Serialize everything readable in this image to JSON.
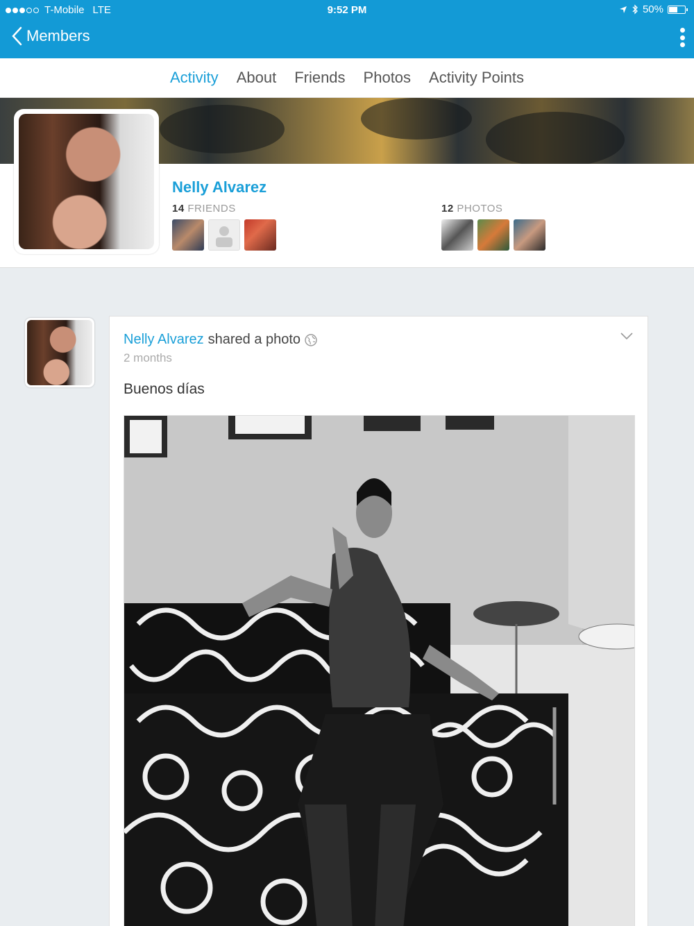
{
  "status_bar": {
    "carrier": "T-Mobile",
    "network": "LTE",
    "time": "9:52 PM",
    "battery": "50%"
  },
  "nav": {
    "back_label": "Members"
  },
  "tabs": [
    {
      "label": "Activity",
      "active": true
    },
    {
      "label": "About"
    },
    {
      "label": "Friends"
    },
    {
      "label": "Photos"
    },
    {
      "label": "Activity Points"
    }
  ],
  "profile": {
    "name": "Nelly Alvarez",
    "friends_count": "14",
    "friends_label": "FRIENDS",
    "photos_count": "12",
    "photos_label": "PHOTOS"
  },
  "post": {
    "author": "Nelly Alvarez",
    "action": "shared a photo",
    "time": "2 months",
    "text": "Buenos días"
  },
  "colors": {
    "brand": "#139ad6",
    "link": "#1a9fd8"
  }
}
